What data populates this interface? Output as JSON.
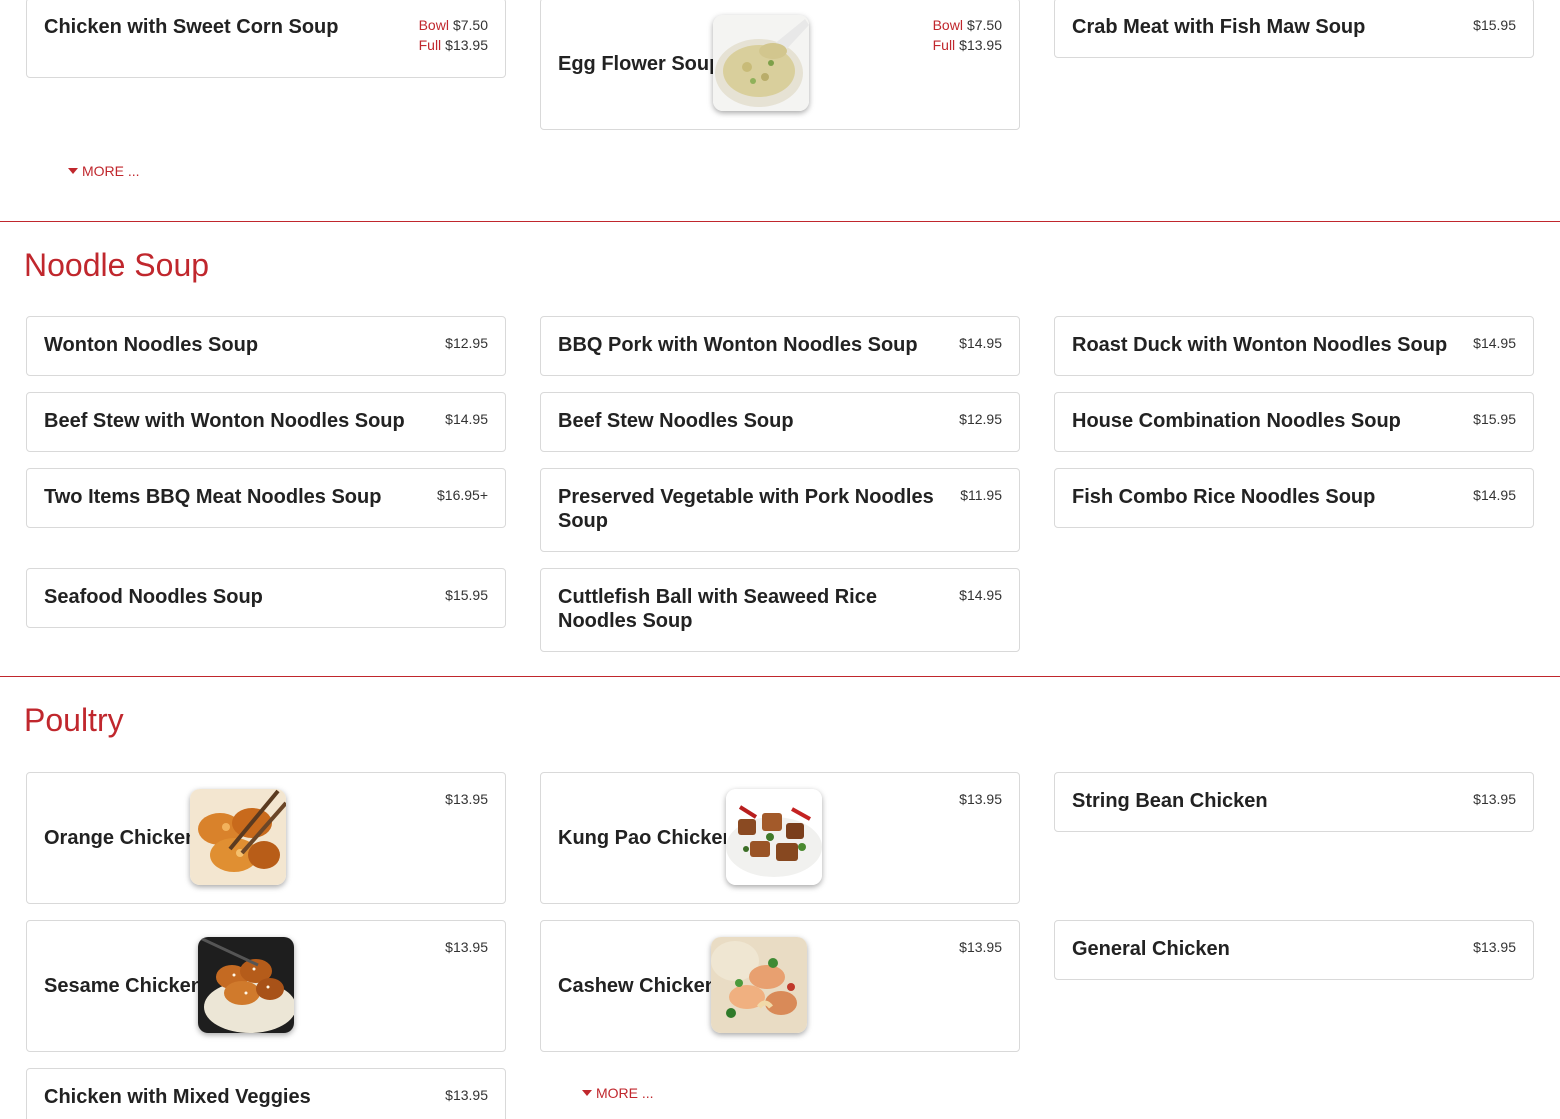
{
  "soup": {
    "items": [
      {
        "name": "Chicken with Sweet Corn Soup",
        "price_label_1": "Bowl",
        "price_1": "$7.50",
        "price_label_2": "Full",
        "price_2": "$13.95"
      },
      {
        "name": "Egg Flower Soup",
        "price_label_1": "Bowl",
        "price_1": "$7.50",
        "price_label_2": "Full",
        "price_2": "$13.95"
      },
      {
        "name": "Crab Meat with Fish Maw Soup",
        "price": "$15.95"
      }
    ],
    "more_label": "MORE ..."
  },
  "noodle_soup": {
    "title": "Noodle Soup",
    "items": [
      {
        "name": "Wonton Noodles Soup",
        "price": "$12.95"
      },
      {
        "name": "BBQ Pork with Wonton Noodles Soup",
        "price": "$14.95"
      },
      {
        "name": "Roast Duck with Wonton Noodles Soup",
        "price": "$14.95"
      },
      {
        "name": "Beef Stew with Wonton Noodles Soup",
        "price": "$14.95"
      },
      {
        "name": "Beef Stew Noodles Soup",
        "price": "$12.95"
      },
      {
        "name": "House Combination Noodles Soup",
        "price": "$15.95"
      },
      {
        "name": "Two Items BBQ Meat Noodles Soup",
        "price": "$16.95+"
      },
      {
        "name": "Preserved Vegetable with Pork Noodles Soup",
        "price": "$11.95"
      },
      {
        "name": "Fish Combo Rice Noodles Soup",
        "price": "$14.95"
      },
      {
        "name": "Seafood Noodles Soup",
        "price": "$15.95"
      },
      {
        "name": "Cuttlefish Ball with Seaweed Rice Noodles Soup",
        "price": "$14.95"
      }
    ]
  },
  "poultry": {
    "title": "Poultry",
    "items": [
      {
        "name": "Orange Chicken",
        "price": "$13.95"
      },
      {
        "name": "Kung Pao Chicken",
        "price": "$13.95"
      },
      {
        "name": "String Bean Chicken",
        "price": "$13.95"
      },
      {
        "name": "Sesame Chicken",
        "price": "$13.95"
      },
      {
        "name": "Cashew Chicken",
        "price": "$13.95"
      },
      {
        "name": "General Chicken",
        "price": "$13.95"
      },
      {
        "name": "Chicken with Mixed Veggies",
        "price": "$13.95"
      }
    ],
    "more_label": "MORE ..."
  },
  "colors": {
    "accent": "#c0272d",
    "card_border": "#d9d9d9",
    "text": "#222222"
  }
}
